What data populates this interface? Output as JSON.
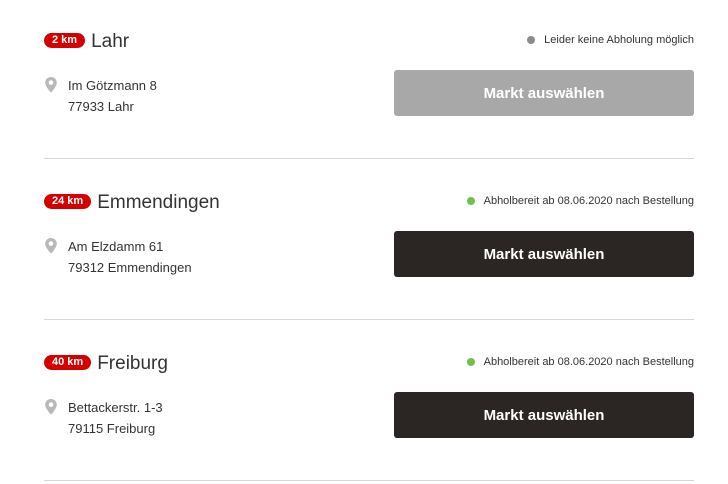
{
  "colors": {
    "distance_badge": "#d40000",
    "status_unavailable": "#8c8c8c",
    "status_available": "#6cc24a",
    "button_active": "#2b2523",
    "button_disabled": "#a8a8a8"
  },
  "stores": [
    {
      "distance": "2 km",
      "city": "Lahr",
      "status": "Leider keine Abholung möglich",
      "status_type": "unavailable",
      "street": "Im Götzmann 8",
      "zip_city": "77933 Lahr",
      "button_label": "Markt auswählen",
      "button_enabled": false,
      "icon": "location-pin-icon"
    },
    {
      "distance": "24 km",
      "city": "Emmendingen",
      "status": "Abholbereit ab 08.06.2020 nach Bestellung",
      "status_type": "available",
      "street": "Am Elzdamm 61",
      "zip_city": "79312 Emmendingen",
      "button_label": "Markt auswählen",
      "button_enabled": true,
      "icon": "location-pin-icon"
    },
    {
      "distance": "40 km",
      "city": "Freiburg",
      "status": "Abholbereit ab 08.06.2020 nach Bestellung",
      "status_type": "available",
      "street": "Bettackerstr. 1-3",
      "zip_city": "79115 Freiburg",
      "button_label": "Markt auswählen",
      "button_enabled": true,
      "icon": "location-pin-icon"
    }
  ]
}
